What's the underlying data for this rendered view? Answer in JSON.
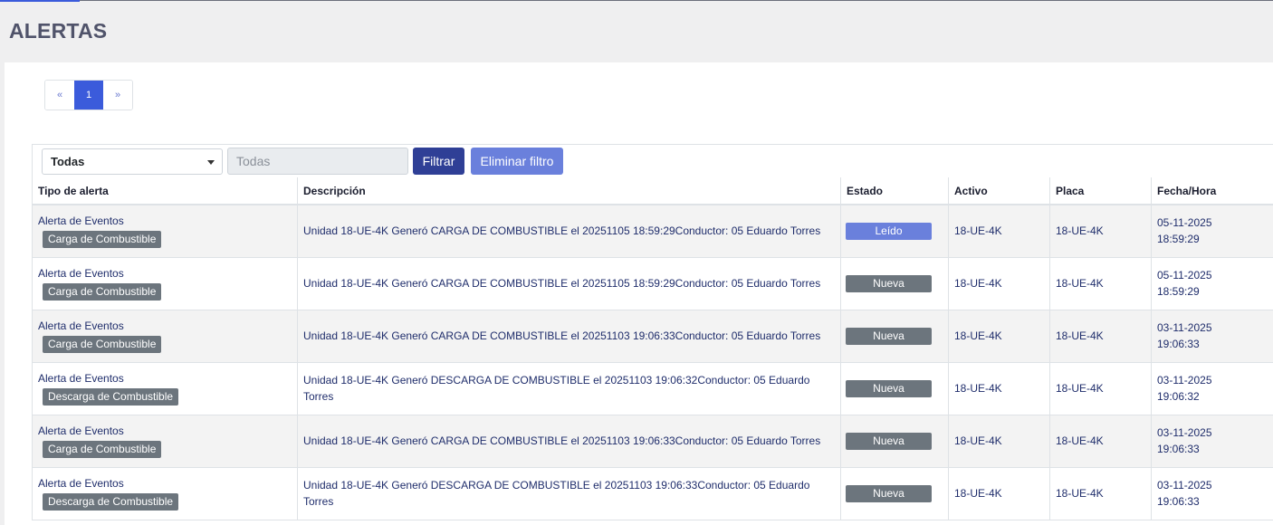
{
  "header": {
    "title": "ALERTAS"
  },
  "pagination": {
    "prev": "«",
    "current": "1",
    "next": "»"
  },
  "filter": {
    "select_value": "Todas",
    "input_placeholder": "Todas",
    "filter_button": "Filtrar",
    "clear_button": "Eliminar filtro"
  },
  "table": {
    "columns": [
      "Tipo de alerta",
      "Descripción",
      "Estado",
      "Activo",
      "Placa",
      "Fecha/Hora"
    ],
    "rows": [
      {
        "type": "Alerta de Eventos",
        "badge": "Carga de Combustible",
        "description": "Unidad 18-UE-4K Generó CARGA DE COMBUSTIBLE el 20251105 18:59:29Conductor: 05 Eduardo Torres",
        "status": "Leído",
        "status_kind": "leido",
        "activo": "18-UE-4K",
        "placa": "18-UE-4K",
        "date": "05-11-2025",
        "time": "18:59:29"
      },
      {
        "type": "Alerta de Eventos",
        "badge": "Carga de Combustible",
        "description": "Unidad 18-UE-4K Generó CARGA DE COMBUSTIBLE el 20251105 18:59:29Conductor: 05 Eduardo Torres",
        "status": "Nueva",
        "status_kind": "nueva",
        "activo": "18-UE-4K",
        "placa": "18-UE-4K",
        "date": "05-11-2025",
        "time": "18:59:29"
      },
      {
        "type": "Alerta de Eventos",
        "badge": "Carga de Combustible",
        "description": "Unidad 18-UE-4K Generó CARGA DE COMBUSTIBLE el 20251103 19:06:33Conductor: 05 Eduardo Torres",
        "status": "Nueva",
        "status_kind": "nueva",
        "activo": "18-UE-4K",
        "placa": "18-UE-4K",
        "date": "03-11-2025",
        "time": "19:06:33"
      },
      {
        "type": "Alerta de Eventos",
        "badge": "Descarga de Combustible",
        "description": "Unidad 18-UE-4K Generó DESCARGA DE COMBUSTIBLE el 20251103 19:06:32Conductor: 05 Eduardo Torres",
        "status": "Nueva",
        "status_kind": "nueva",
        "activo": "18-UE-4K",
        "placa": "18-UE-4K",
        "date": "03-11-2025",
        "time": "19:06:32"
      },
      {
        "type": "Alerta de Eventos",
        "badge": "Carga de Combustible",
        "description": "Unidad 18-UE-4K Generó CARGA DE COMBUSTIBLE el 20251103 19:06:33Conductor: 05 Eduardo Torres",
        "status": "Nueva",
        "status_kind": "nueva",
        "activo": "18-UE-4K",
        "placa": "18-UE-4K",
        "date": "03-11-2025",
        "time": "19:06:33"
      },
      {
        "type": "Alerta de Eventos",
        "badge": "Descarga de Combustible",
        "description": "Unidad 18-UE-4K Generó DESCARGA DE COMBUSTIBLE el 20251103 19:06:33Conductor: 05 Eduardo Torres",
        "status": "Nueva",
        "status_kind": "nueva",
        "activo": "18-UE-4K",
        "placa": "18-UE-4K",
        "date": "03-11-2025",
        "time": "19:06:33"
      }
    ]
  },
  "colors": {
    "primary": "#3b5bdb",
    "filter_button": "#2f3f96",
    "clear_button": "#6a80dc",
    "badge_gray": "#6c757d",
    "link_text": "#1f2d6b"
  }
}
